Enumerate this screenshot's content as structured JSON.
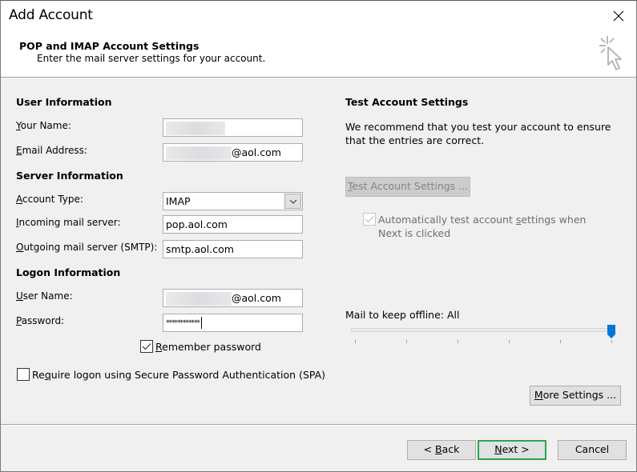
{
  "window": {
    "title": "Add Account",
    "close_icon": "close-icon"
  },
  "header": {
    "section_title": "POP and IMAP Account Settings",
    "section_subtitle": "Enter the mail server settings for your account.",
    "icon": "cursor-click-icon"
  },
  "user_info": {
    "heading": "User Information",
    "your_name_label_mnemonic": "Y",
    "your_name_label_rest": "our Name:",
    "your_name_value": "",
    "email_label_mnemonic": "E",
    "email_label_rest": "mail Address:",
    "email_value_visible": "@aol.com"
  },
  "server_info": {
    "heading": "Server Information",
    "account_type_label_mnemonic": "A",
    "account_type_label_rest": "ccount Type:",
    "account_type_value": "IMAP",
    "incoming_label_mnemonic": "I",
    "incoming_label_rest": "ncoming mail server:",
    "incoming_value": "pop.aol.com",
    "outgoing_label_mnemonic": "O",
    "outgoing_label_rest": "utgoing mail server (SMTP):",
    "outgoing_value": "smtp.aol.com"
  },
  "logon_info": {
    "heading": "Logon Information",
    "username_label_mnemonic": "U",
    "username_label_rest": "ser Name:",
    "username_value_visible": "@aol.com",
    "password_label_mnemonic": "P",
    "password_label_rest": "assword:",
    "password_value": "************",
    "remember_password_mnemonic": "R",
    "remember_password_rest": "emember password",
    "remember_password_checked": true,
    "spa_label_pre": "Re",
    "spa_label_mnemonic": "q",
    "spa_label_rest": "uire logon using Secure Password Authentication (SPA)",
    "spa_checked": false
  },
  "test_settings": {
    "heading": "Test Account Settings",
    "description": "We recommend that you test your account to ensure that the entries are correct.",
    "test_button_mnemonic": "T",
    "test_button_rest": "est Account Settings ...",
    "test_button_enabled": false,
    "auto_test_label_pre": "Automatically test account ",
    "auto_test_label_mnemonic": "s",
    "auto_test_label_rest": "ettings when Next is clicked",
    "auto_test_checked": true,
    "auto_test_enabled": false
  },
  "offline": {
    "label": "Mail to keep offline:",
    "value": "All",
    "slider_position": 1.0,
    "tick_count": 6
  },
  "buttons": {
    "more_settings_mnemonic": "M",
    "more_settings_rest": "ore Settings ...",
    "back_pre": "< ",
    "back_mnemonic": "B",
    "back_rest": "ack",
    "next_mnemonic": "N",
    "next_rest": "ext >",
    "cancel": "Cancel"
  },
  "colors": {
    "accent": "#0078d7",
    "default_button_border": "#2ea44f"
  }
}
